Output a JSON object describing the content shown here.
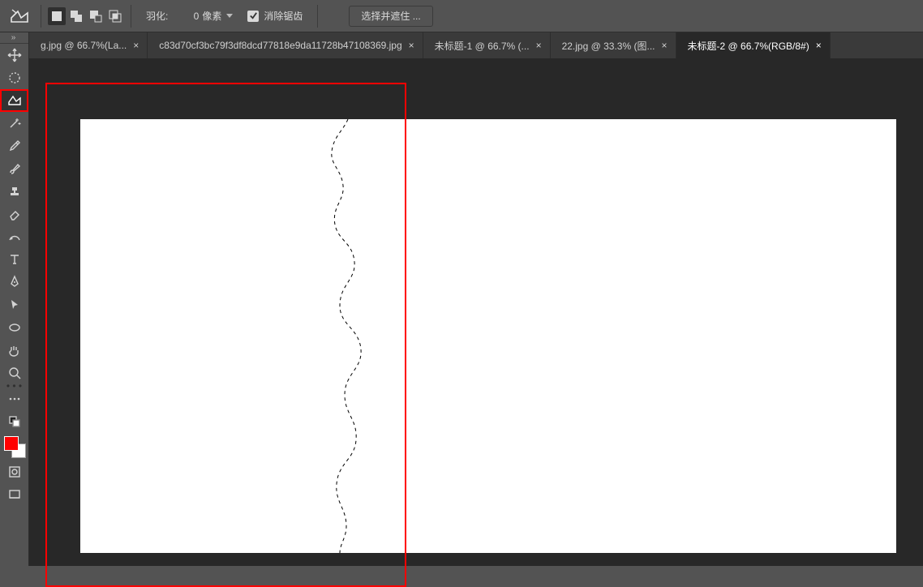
{
  "options_bar": {
    "feather_label": "羽化:",
    "feather_value": "0",
    "feather_unit": "像素",
    "antialias_checked": true,
    "antialias_label": "消除锯齿",
    "select_and_mask": "选择并遮住 ..."
  },
  "tabs": [
    {
      "label": "g.jpg @ 66.7%(La...",
      "active": false
    },
    {
      "label": "c83d70cf3bc79f3df8dcd77818e9da11728b47108369.jpg",
      "active": false
    },
    {
      "label": "未标题-1 @ 66.7% (...",
      "active": false
    },
    {
      "label": "22.jpg @ 33.3% (图...",
      "active": false
    },
    {
      "label": "未标题-2 @ 66.7%(RGB/8#)",
      "active": true
    }
  ],
  "tab_close_glyph": "×",
  "tools": [
    {
      "name": "move-tool"
    },
    {
      "name": "marquee-tool"
    },
    {
      "name": "lasso-tool",
      "selected": true
    },
    {
      "name": "magic-wand-tool"
    },
    {
      "name": "eyedropper-tool"
    },
    {
      "name": "brush-tool"
    },
    {
      "name": "stamp-tool"
    },
    {
      "name": "eraser-tool"
    },
    {
      "name": "gradient-tool"
    },
    {
      "name": "type-tool"
    },
    {
      "name": "pen-tool"
    },
    {
      "name": "path-select-tool"
    },
    {
      "name": "shape-tool"
    },
    {
      "name": "hand-tool"
    },
    {
      "name": "zoom-tool"
    }
  ],
  "swatches": {
    "foreground": "#ff0000",
    "background": "#ffffff"
  }
}
